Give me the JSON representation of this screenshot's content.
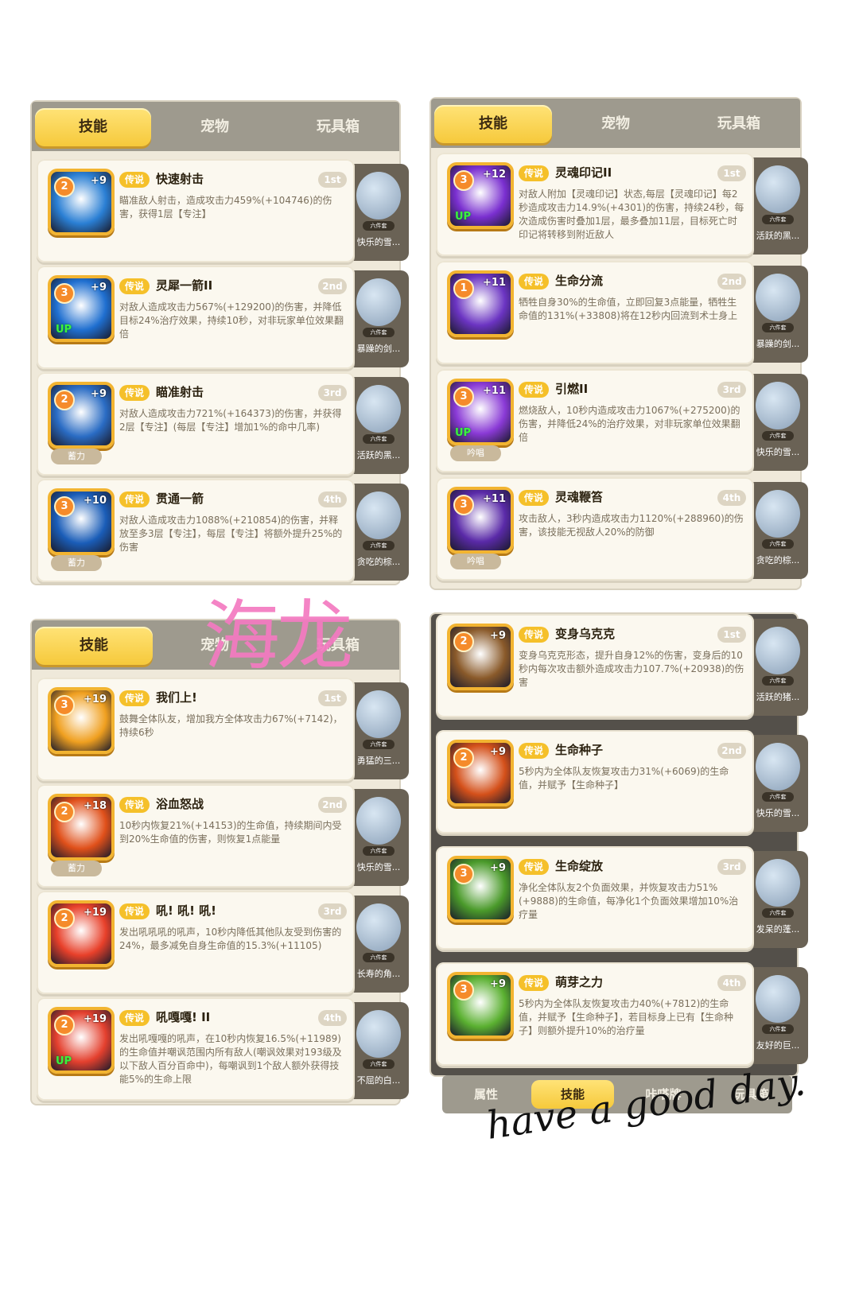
{
  "watermark": "海龙",
  "signature": "have a good day.",
  "tabs": [
    "技能",
    "宠物",
    "玩具箱"
  ],
  "legend_label": "传说",
  "bottom_tabs": [
    "属性",
    "技能",
    "咔嗒牌",
    "玩具箱"
  ],
  "pet_badge": "六件套",
  "panels": [
    {
      "cards": [
        {
          "level": "2",
          "plus": "+9",
          "name": "快速射击",
          "order": "1st",
          "desc": "瞄准敌人射击，造成攻击力459%(+104746)的伤害，获得1层【专注】",
          "tag": "",
          "up": "",
          "pet": "快乐的雪...",
          "color": "#2a7fd4"
        },
        {
          "level": "3",
          "plus": "+9",
          "name": "灵犀一箭II",
          "order": "2nd",
          "desc": "对敌人造成攻击力567%(+129200)的伤害，并降低目标24%治疗效果，持续10秒，对非玩家单位效果翻倍",
          "tag": "",
          "up": "UP",
          "pet": "暴躁的剑...",
          "color": "#1f6fd0"
        },
        {
          "level": "2",
          "plus": "+9",
          "name": "瞄准射击",
          "order": "3rd",
          "desc": "对敌人造成攻击力721%(+164373)的伤害，并获得2层【专注】(每层【专注】增加1%的命中几率)",
          "tag": "蓄力",
          "up": "",
          "pet": "活跃的黑...",
          "color": "#2a6cc4"
        },
        {
          "level": "3",
          "plus": "+10",
          "name": "贯通一箭",
          "order": "4th",
          "desc": "对敌人造成攻击力1088%(+210854)的伤害，并释放至多3层【专注】，每层【专注】将额外提升25%的伤害",
          "tag": "蓄力",
          "up": "",
          "pet": "贪吃的棕...",
          "color": "#1a5db8"
        }
      ]
    },
    {
      "cards": [
        {
          "level": "3",
          "plus": "+12",
          "name": "灵魂印记II",
          "order": "1st",
          "desc": "对敌人附加【灵魂印记】状态,每层【灵魂印记】每2秒造成攻击力14.9%(+4301)的伤害，持续24秒，每次造成伤害时叠加1层，最多叠加11层，目标死亡时印记将转移到附近敌人",
          "tag": "",
          "up": "UP",
          "pet": "活跃的黑...",
          "color": "#7a2fd0"
        },
        {
          "level": "1",
          "plus": "+11",
          "name": "生命分流",
          "order": "2nd",
          "desc": "牺牲自身30%的生命值，立即回复3点能量，牺牲生命值的131%(+33808)将在12秒内回流到术士身上",
          "tag": "",
          "up": "",
          "pet": "暴躁的剑...",
          "color": "#6b34c2"
        },
        {
          "level": "3",
          "plus": "+11",
          "name": "引燃II",
          "order": "3rd",
          "desc": "燃烧敌人，10秒内造成攻击力1067%(+275200)的伤害，并降低24%的治疗效果，对非玩家单位效果翻倍",
          "tag": "吟唱",
          "up": "UP",
          "pet": "快乐的雪...",
          "color": "#8a3ad6"
        },
        {
          "level": "3",
          "plus": "+11",
          "name": "灵魂鞭笞",
          "order": "4th",
          "desc": "攻击敌人，3秒内造成攻击力1120%(+288960)的伤害，该技能无视敌人20%的防御",
          "tag": "吟唱",
          "up": "",
          "pet": "贪吃的棕...",
          "color": "#5a2aa8"
        }
      ]
    },
    {
      "cards": [
        {
          "level": "3",
          "plus": "+19",
          "name": "我们上!",
          "order": "1st",
          "desc": "鼓舞全体队友，增加我方全体攻击力67%(+7142)，持续6秒",
          "tag": "",
          "up": "",
          "pet": "勇猛的三...",
          "color": "#f0a020"
        },
        {
          "level": "2",
          "plus": "+18",
          "name": "浴血怒战",
          "order": "2nd",
          "desc": "10秒内恢复21%(+14153)的生命值，持续期间内受到20%生命值的伤害，则恢复1点能量",
          "tag": "蓄力",
          "up": "",
          "pet": "快乐的雪...",
          "color": "#e0501a"
        },
        {
          "level": "2",
          "plus": "+19",
          "name": "吼! 吼! 吼!",
          "order": "3rd",
          "desc": "发出吼吼吼的吼声，10秒内降低其他队友受到伤害的24%，最多减免自身生命值的15.3%(+11105)",
          "tag": "",
          "up": "",
          "pet": "长寿的角...",
          "color": "#e8402a"
        },
        {
          "level": "2",
          "plus": "+19",
          "name": "吼嘎嘎! II",
          "order": "4th",
          "desc": "发出吼嘎嘎的吼声，在10秒内恢复16.5%(+11989)的生命值并嘲讽范围内所有敌人(嘲讽效果对193级及以下敌人百分百命中)，每嘲讽到1个敌人额外获得技能5%的生命上限",
          "tag": "",
          "up": "UP",
          "pet": "不屈的白...",
          "color": "#e4402e"
        }
      ]
    },
    {
      "cards": [
        {
          "level": "2",
          "plus": "+9",
          "name": "变身乌克克",
          "order": "1st",
          "desc": "变身乌克克形态，提升自身12%的伤害，变身后的10秒内每次攻击额外造成攻击力107.7%(+20938)的伤害",
          "tag": "",
          "up": "",
          "pet": "活跃的猪...",
          "color": "#8a5a2a"
        },
        {
          "level": "2",
          "plus": "+9",
          "name": "生命种子",
          "order": "2nd",
          "desc": "5秒内为全体队友恢复攻击力31%(+6069)的生命值，并赋予【生命种子】",
          "tag": "",
          "up": "",
          "pet": "快乐的雪...",
          "color": "#d4501a"
        },
        {
          "level": "3",
          "plus": "+9",
          "name": "生命绽放",
          "order": "3rd",
          "desc": "净化全体队友2个负面效果，并恢复攻击力51%(+9888)的生命值，每净化1个负面效果增加10%治疗量",
          "tag": "",
          "up": "",
          "pet": "发呆的蓬...",
          "color": "#4a9a2a"
        },
        {
          "level": "3",
          "plus": "+9",
          "name": "萌芽之力",
          "order": "4th",
          "desc": "5秒内为全体队友恢复攻击力40%(+7812)的生命值，并赋予【生命种子】，若目标身上已有【生命种子】则额外提升10%的治疗量",
          "tag": "",
          "up": "",
          "pet": "友好的巨...",
          "color": "#5ab030"
        }
      ]
    }
  ]
}
